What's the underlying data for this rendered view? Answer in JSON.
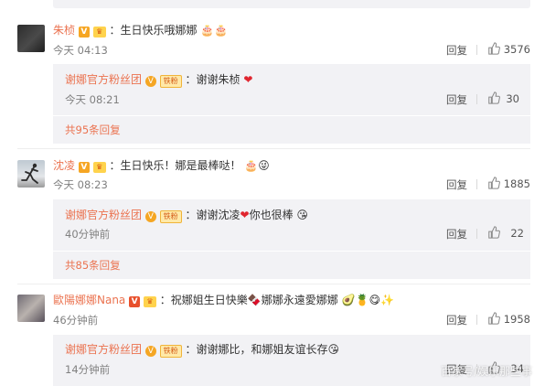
{
  "comments": [
    {
      "user": "朱桢",
      "text": "：生日快乐哦娜娜",
      "emojis": "🎂🎂",
      "time": "今天 04:13",
      "reply_label": "回复",
      "likes": "3576",
      "reply": {
        "user": "谢娜官方粉丝团",
        "badge": "铁粉",
        "text": "：谢谢朱桢",
        "emojis": "❤",
        "time": "今天 08:21",
        "reply_label": "回复",
        "likes": "30"
      },
      "more": "共95条回复"
    },
    {
      "user": "沈凌",
      "text": "：生日快乐！娜是最棒哒！",
      "emojis": "🎂😜",
      "time": "今天 08:23",
      "reply_label": "回复",
      "likes": "1885",
      "reply": {
        "user": "谢娜官方粉丝团",
        "badge": "铁粉",
        "text": "：谢谢沈凌",
        "text2": "你也很棒",
        "emojis": "❤",
        "emojis2": "😘",
        "time": "40分钟前",
        "reply_label": "回复",
        "likes": "22"
      },
      "more": "共85条回复"
    },
    {
      "user": "歐陽娜娜Nana",
      "text": "：祝娜姐生日快樂",
      "text2": "娜娜永遠愛娜娜",
      "emojis": "🍫",
      "emojis2": "🥑🍍😋✨",
      "time": "46分钟前",
      "reply_label": "回复",
      "likes": "1958",
      "reply": {
        "user": "谢娜官方粉丝团",
        "badge": "铁粉",
        "text": "：谢谢娜比，和娜姐友谊长存",
        "emojis": "😘",
        "time": "14分钟前",
        "reply_label": "回复",
        "likes": "34"
      }
    }
  ],
  "watermark": "百家号/娱乐那些事"
}
